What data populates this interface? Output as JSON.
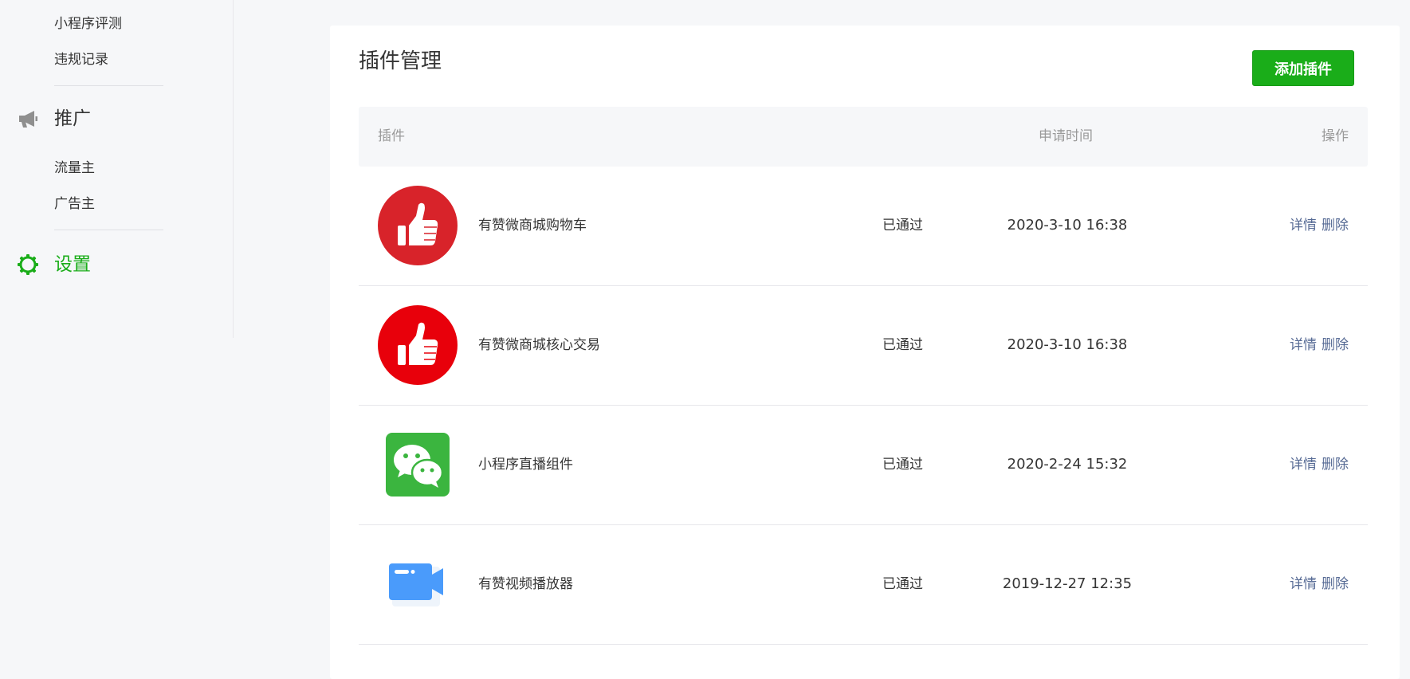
{
  "sidebar": {
    "top_links": [
      {
        "label": "小程序评测"
      },
      {
        "label": "违规记录"
      }
    ],
    "promo": {
      "label": "推广",
      "icon": "megaphone-icon",
      "items": [
        {
          "label": "流量主"
        },
        {
          "label": "广告主"
        }
      ]
    },
    "settings": {
      "label": "设置",
      "icon": "gear-icon",
      "active_color": "#1aad19"
    }
  },
  "main": {
    "title": "插件管理",
    "add_button": "添加插件",
    "table": {
      "columns": {
        "plugin": "插件",
        "apply_time": "申请时间",
        "ops": "操作"
      },
      "rows": [
        {
          "name": "有赞微商城购物车",
          "status": "已通过",
          "time": "2020-3-10 16:38",
          "icon": "thumbs-up-icon",
          "icon_color": "#d8232a",
          "detail": "详情",
          "delete": "删除"
        },
        {
          "name": "有赞微商城核心交易",
          "status": "已通过",
          "time": "2020-3-10 16:38",
          "icon": "thumbs-up-icon",
          "icon_color": "#e8000b",
          "detail": "详情",
          "delete": "删除"
        },
        {
          "name": "小程序直播组件",
          "status": "已通过",
          "time": "2020-2-24 15:32",
          "icon": "wechat-icon",
          "icon_color": "#3bb53f",
          "detail": "详情",
          "delete": "删除"
        },
        {
          "name": "有赞视频播放器",
          "status": "已通过",
          "time": "2019-12-27 12:35",
          "icon": "video-camera-icon",
          "icon_color": "#4a9bfb",
          "detail": "详情",
          "delete": "删除"
        }
      ]
    }
  },
  "colors": {
    "primary": "#1aad19",
    "link": "#576b95",
    "background": "#f6f7f9"
  }
}
